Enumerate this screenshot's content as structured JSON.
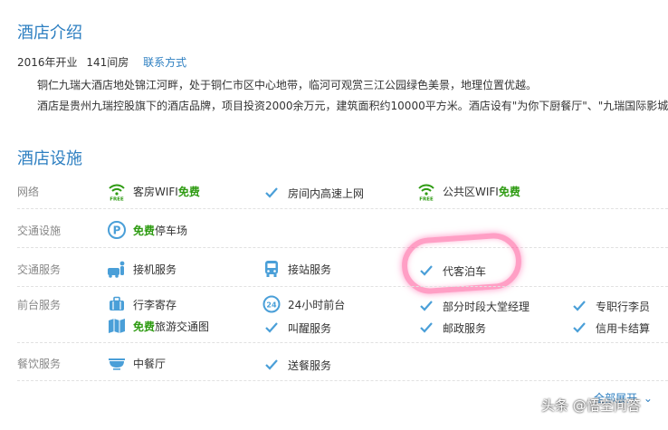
{
  "intro": {
    "title": "酒店介绍",
    "opened": "2016年开业",
    "rooms": "141间房",
    "contact_link": "联系方式",
    "paragraphs": [
      "铜仁九瑞大酒店地处锦江河畔，处于铜仁市区中心地带，临河可观赏三江公园绿色美景，地理位置优越。",
      "酒店是贵州九瑞控股旗下的酒店品牌，项目投资2000余万元，建筑面积约10000平方米。酒店设有\"为你下厨餐厅\"、\"九瑞国际影城\""
    ]
  },
  "facilities": {
    "title": "酒店设施",
    "rows": [
      {
        "label": "网络",
        "items": [
          {
            "icon": "wifi-free-icon",
            "text": "客房WIFI",
            "green": "免费"
          },
          {
            "icon": "check-icon",
            "text": "房间内高速上网"
          },
          {
            "icon": "wifi-free-icon",
            "text": "公共区WIFI",
            "green": "免费"
          }
        ]
      },
      {
        "label": "交通设施",
        "items": [
          {
            "icon": "parking-icon",
            "green_prefix": "免费",
            "text": "停车场"
          }
        ]
      },
      {
        "label": "交通服务",
        "items": [
          {
            "icon": "airport-pickup-icon",
            "text": "接机服务"
          },
          {
            "icon": "bus-icon",
            "text": "接站服务"
          },
          {
            "icon": "check-icon",
            "text": "代客泊车"
          }
        ]
      },
      {
        "label": "前台服务",
        "items": [
          {
            "icon": "luggage-icon",
            "text": "行李寄存"
          },
          {
            "icon": "24h-icon",
            "text": "24小时前台"
          },
          {
            "icon": "check-icon",
            "text": "部分时段大堂经理"
          },
          {
            "icon": "check-icon",
            "text": "专职行李员"
          },
          {
            "icon": "map-icon",
            "green_prefix": "免费",
            "text": "旅游交通图"
          },
          {
            "icon": "check-icon",
            "text": "叫醒服务"
          },
          {
            "icon": "check-icon",
            "text": "邮政服务"
          },
          {
            "icon": "check-icon",
            "text": "信用卡结算"
          }
        ]
      },
      {
        "label": "餐饮服务",
        "items": [
          {
            "icon": "restaurant-icon",
            "text": "中餐厅"
          },
          {
            "icon": "check-icon",
            "text": "送餐服务"
          }
        ]
      }
    ],
    "expand_link": "全部展开",
    "expand_icon": "chevron-down-icon"
  },
  "watermark": "头条 @悟空问答",
  "colors": {
    "title_blue": "#2d7fc1",
    "free_green": "#2e9b12",
    "icon_blue": "#4a9fd8",
    "highlight_pink": "#ff5096"
  }
}
